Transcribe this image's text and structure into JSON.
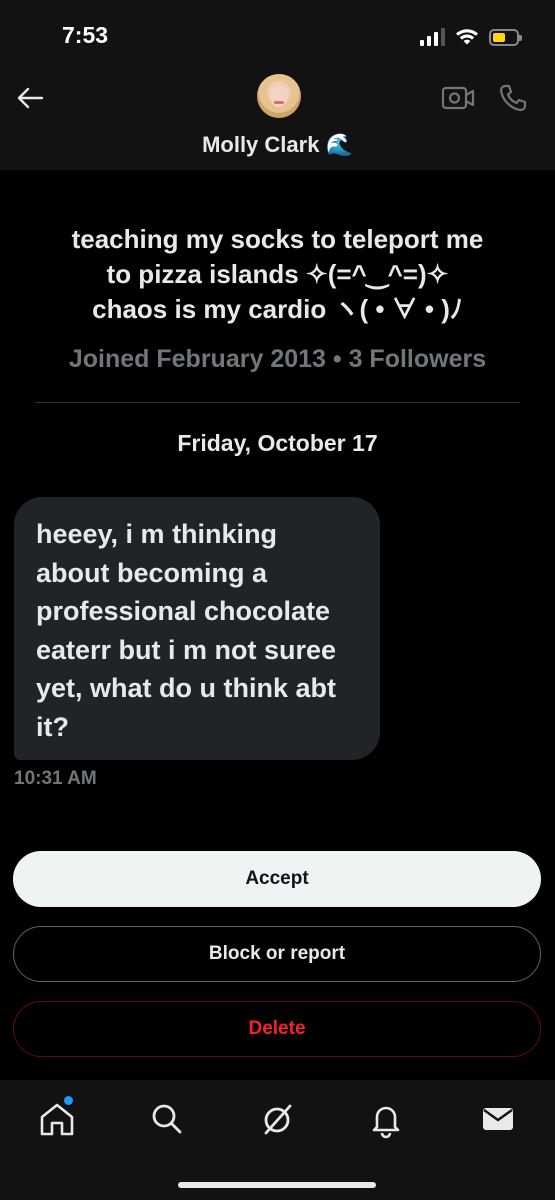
{
  "status_bar": {
    "time": "7:53"
  },
  "header": {
    "contact_name": "Molly Clark 🌊"
  },
  "profile": {
    "bio_lines": [
      "teaching my socks to teleport me",
      "to pizza islands ✧(=^‿^=)✧",
      "chaos is my cardio ヽ( • ∀ • )ﾉ"
    ],
    "meta": "Joined February 2013 • 3 Followers"
  },
  "conversation": {
    "date_label": "Friday, October 17",
    "message": {
      "text": "heeey, i m thinking about becoming a professional chocolate eaterr but i m not suree yet, what do u think abt it?",
      "time": "10:31 AM"
    }
  },
  "actions": {
    "accept_label": "Accept",
    "block_label": "Block or report",
    "delete_label": "Delete"
  },
  "colors": {
    "accent": "#1d9bf0",
    "delete": "#f4212e",
    "bubble": "#202327"
  },
  "tab_bar": {
    "icons": [
      "home-icon",
      "search-icon",
      "grok-icon",
      "notifications-icon",
      "messages-icon"
    ]
  }
}
